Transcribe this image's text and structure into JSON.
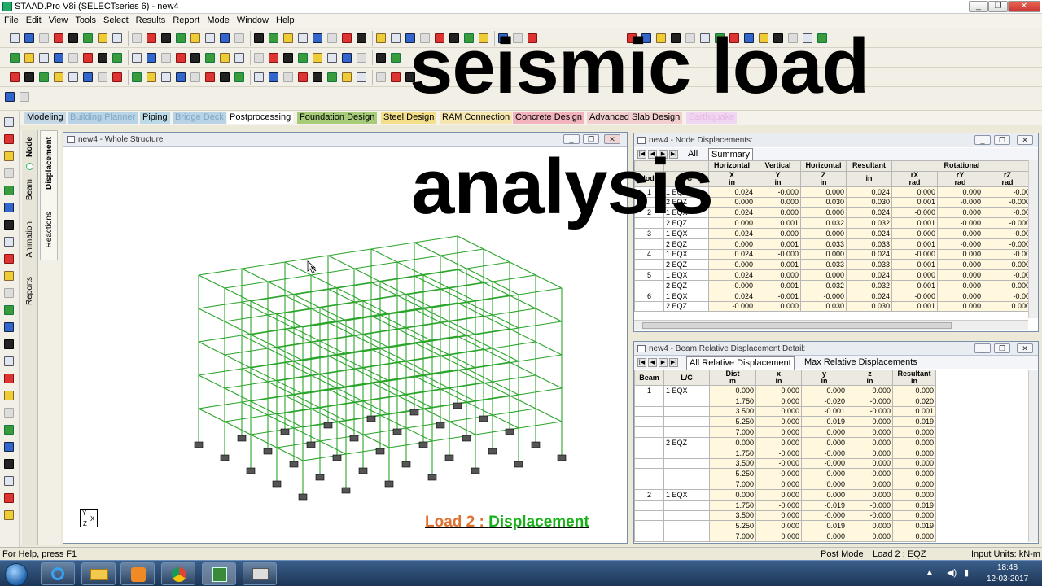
{
  "app": {
    "title": "STAAD.Pro V8i (SELECTseries 6) - new4",
    "window_controls": [
      "_",
      "❐",
      "✕"
    ]
  },
  "menu": [
    "File",
    "Edit",
    "View",
    "Tools",
    "Select",
    "Results",
    "Report",
    "Mode",
    "Window",
    "Help"
  ],
  "mode_tabs": [
    {
      "label": "Modeling",
      "bg": "#c4d8e6",
      "color": "#000"
    },
    {
      "label": "Building Planner",
      "bg": "#b9d3e6",
      "color": "#7fa6c6"
    },
    {
      "label": "Piping",
      "bg": "#bcd9e8",
      "color": "#000"
    },
    {
      "label": "Bridge Deck",
      "bg": "#b9d3e6",
      "color": "#7fa6c6"
    },
    {
      "label": "Postprocessing",
      "bg": "#ffffff",
      "color": "#000"
    },
    {
      "label": "Foundation Design",
      "bg": "#a6cc7a",
      "color": "#000"
    },
    {
      "label": "Steel Design",
      "bg": "#f3df8a",
      "color": "#000"
    },
    {
      "label": "RAM Connection",
      "bg": "#f5e6b0",
      "color": "#000"
    },
    {
      "label": "Concrete Design",
      "bg": "#f2b3bd",
      "color": "#000"
    },
    {
      "label": "Advanced Slab Design",
      "bg": "#f1cfcf",
      "color": "#000"
    },
    {
      "label": "Earthquake",
      "bg": "#f0d6f0",
      "color": "#e8b8e8"
    }
  ],
  "side_tabs": {
    "node": "Node",
    "beam": "Beam",
    "animation": "Animation",
    "reports": "Reports",
    "displacement": "Displacement",
    "reactions": "Reactions"
  },
  "structure_window": {
    "title": "new4 - Whole Structure",
    "axis": {
      "y": "Y",
      "x": "X",
      "z": "Z"
    },
    "load_caption": "Load 2 :",
    "result_caption": "Displacement",
    "colors": {
      "frame": "#2aa52a",
      "caption_load": "#e07030",
      "caption_result": "#18b018"
    }
  },
  "node_window": {
    "title": "new4 - Node Displacements:",
    "tabs": [
      "All",
      "Summary"
    ],
    "headers_top": [
      "",
      "",
      "Horizontal",
      "Vertical",
      "Horizontal",
      "Resultant",
      "Rotational"
    ],
    "headers_sub": [
      "Node",
      "L/C",
      "X\nin",
      "Y\nin",
      "Z\nin",
      "in",
      "rX\nrad",
      "rY\nrad",
      "rZ\nrad"
    ],
    "rows": [
      [
        "1",
        "1 EQX",
        "0.024",
        "-0.000",
        "0.000",
        "0.024",
        "0.000",
        "0.000",
        "-0.00"
      ],
      [
        "",
        "2 EQZ",
        "0.000",
        "0.000",
        "0.030",
        "0.030",
        "0.001",
        "-0.000",
        "-0.000"
      ],
      [
        "2",
        "1 EQX",
        "0.024",
        "0.000",
        "0.000",
        "0.024",
        "-0.000",
        "0.000",
        "-0.00"
      ],
      [
        "",
        "2 EQZ",
        "0.000",
        "0.001",
        "0.032",
        "0.032",
        "0.001",
        "-0.000",
        "-0.000"
      ],
      [
        "3",
        "1 EQX",
        "0.024",
        "0.000",
        "0.000",
        "0.024",
        "0.000",
        "0.000",
        "-0.00"
      ],
      [
        "",
        "2 EQZ",
        "0.000",
        "0.001",
        "0.033",
        "0.033",
        "0.001",
        "-0.000",
        "-0.000"
      ],
      [
        "4",
        "1 EQX",
        "0.024",
        "-0.000",
        "0.000",
        "0.024",
        "-0.000",
        "0.000",
        "-0.00"
      ],
      [
        "",
        "2 EQZ",
        "-0.000",
        "0.001",
        "0.033",
        "0.033",
        "0.001",
        "0.000",
        "0.000"
      ],
      [
        "5",
        "1 EQX",
        "0.024",
        "0.000",
        "0.000",
        "0.024",
        "0.000",
        "0.000",
        "-0.00"
      ],
      [
        "",
        "2 EQZ",
        "-0.000",
        "0.001",
        "0.032",
        "0.032",
        "0.001",
        "0.000",
        "0.000"
      ],
      [
        "6",
        "1 EQX",
        "0.024",
        "-0.001",
        "-0.000",
        "0.024",
        "-0.000",
        "0.000",
        "-0.00"
      ],
      [
        "",
        "2 EQZ",
        "-0.000",
        "0.000",
        "0.030",
        "0.030",
        "0.001",
        "0.000",
        "0.000"
      ]
    ]
  },
  "beam_window": {
    "title": "new4 - Beam Relative Displacement Detail:",
    "tabs": [
      "All Relative Displacement",
      "Max Relative Displacements"
    ],
    "headers": [
      "Beam",
      "L/C",
      "Dist\nm",
      "x\nin",
      "y\nin",
      "z\nin",
      "Resultant\nin"
    ],
    "rows": [
      [
        "1",
        "1 EQX",
        "0.000",
        "0.000",
        "0.000",
        "0.000",
        "0.000"
      ],
      [
        "",
        "",
        "1.750",
        "0.000",
        "-0.020",
        "-0.000",
        "0.020"
      ],
      [
        "",
        "",
        "3.500",
        "0.000",
        "-0.001",
        "-0.000",
        "0.001"
      ],
      [
        "",
        "",
        "5.250",
        "0.000",
        "0.019",
        "0.000",
        "0.019"
      ],
      [
        "",
        "",
        "7.000",
        "0.000",
        "0.000",
        "0.000",
        "0.000"
      ],
      [
        "",
        "2 EQZ",
        "0.000",
        "0.000",
        "0.000",
        "0.000",
        "0.000"
      ],
      [
        "",
        "",
        "1.750",
        "-0.000",
        "-0.000",
        "0.000",
        "0.000"
      ],
      [
        "",
        "",
        "3.500",
        "-0.000",
        "-0.000",
        "0.000",
        "0.000"
      ],
      [
        "",
        "",
        "5.250",
        "-0.000",
        "0.000",
        "-0.000",
        "0.000"
      ],
      [
        "",
        "",
        "7.000",
        "0.000",
        "0.000",
        "0.000",
        "0.000"
      ],
      [
        "2",
        "1 EQX",
        "0.000",
        "0.000",
        "0.000",
        "0.000",
        "0.000"
      ],
      [
        "",
        "",
        "1.750",
        "-0.000",
        "-0.019",
        "-0.000",
        "0.019"
      ],
      [
        "",
        "",
        "3.500",
        "0.000",
        "-0.000",
        "-0.000",
        "0.000"
      ],
      [
        "",
        "",
        "5.250",
        "0.000",
        "0.019",
        "0.000",
        "0.019"
      ],
      [
        "",
        "",
        "7.000",
        "0.000",
        "0.000",
        "0.000",
        "0.000"
      ]
    ]
  },
  "overlay": {
    "line1": "seismic load",
    "line2": "analysis"
  },
  "status": {
    "help": "For Help, press F1",
    "mode": "Post Mode",
    "load": "Load 2 : EQZ",
    "units": "Input Units:  kN-m"
  },
  "taskbar": {
    "time": "18:48",
    "date": "12-03-2017"
  }
}
